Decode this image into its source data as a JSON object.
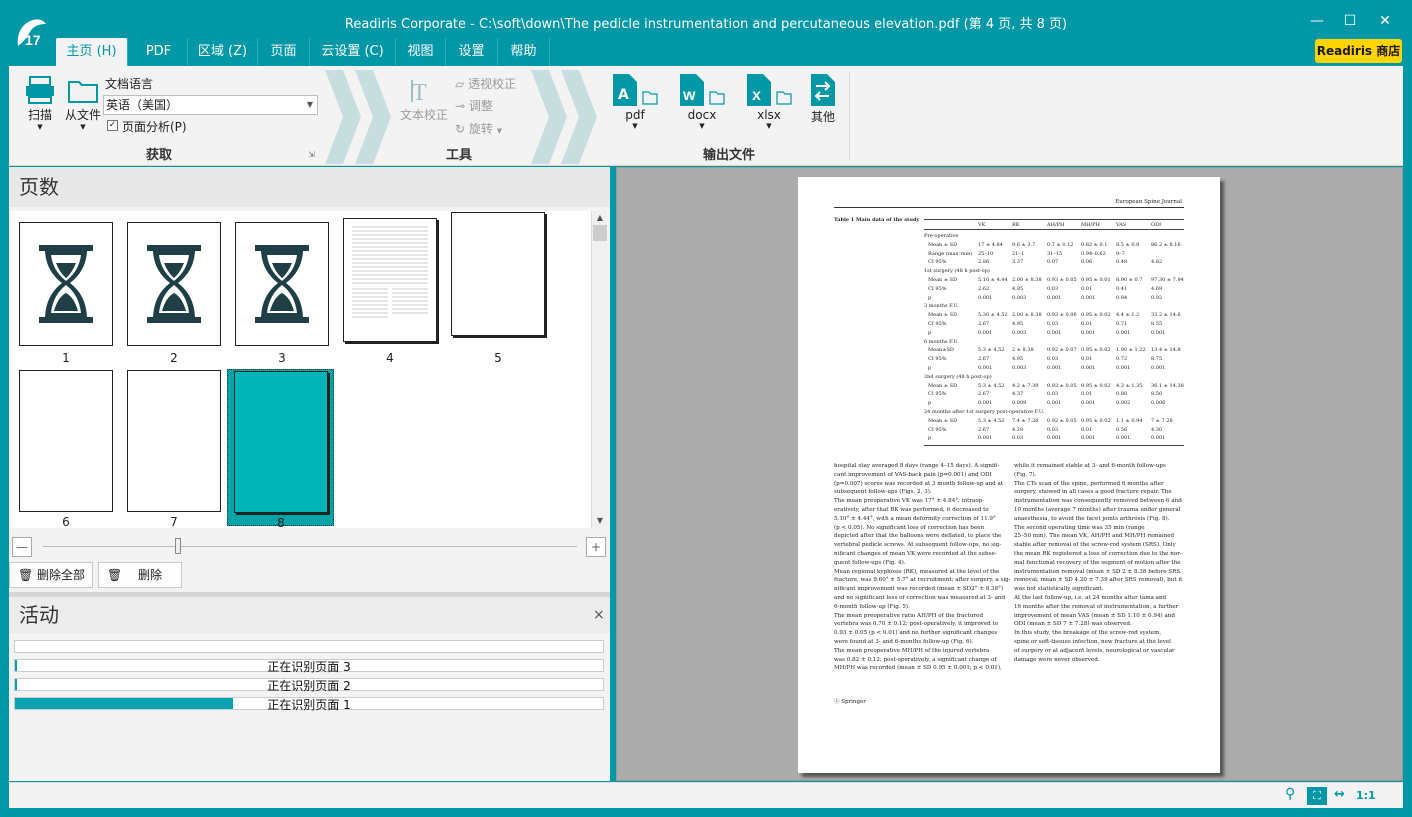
{
  "window": {
    "title": "Readiris Corporate - C:\\soft\\down\\The pedicle instrumentation and percutaneous elevation.pdf (第 4 页, 共 8 页)",
    "logo_text": "17",
    "minimize": "—",
    "maximize": "☐",
    "close": "✕"
  },
  "tabs": [
    "主页 (H)",
    "PDF",
    "区域 (Z)",
    "页面",
    "云设置 (C)",
    "视图",
    "设置",
    "帮助"
  ],
  "store_label": "Readiris 商店",
  "ribbon": {
    "acquire": {
      "scan": "扫描",
      "from_file": "从文件",
      "lang_label": "文档语言",
      "lang_value": "英语（美国）",
      "page_analysis": "页面分析(P)",
      "group": "获取"
    },
    "tools": {
      "text_correct": "文本校正",
      "perspective": "透视校正",
      "adjust": "调整",
      "rotate": "旋转",
      "group": "工具"
    },
    "output": {
      "pdf": "pdf",
      "docx": "docx",
      "xlsx": "xlsx",
      "other": "其他",
      "group": "输出文件"
    }
  },
  "pages_panel": {
    "title": "页数",
    "page_numbers": [
      "1",
      "2",
      "3",
      "4",
      "5",
      "6",
      "7",
      "8"
    ],
    "delete_all": "删除全部",
    "delete": "删除"
  },
  "activity_panel": {
    "title": "活动",
    "close": "×",
    "rows": [
      {
        "text": "",
        "progress": 0
      },
      {
        "text": "正在识别页面 3",
        "progress": 0.003
      },
      {
        "text": "正在识别页面 2",
        "progress": 0.003
      },
      {
        "text": "正在识别页面 1",
        "progress": 0.37
      }
    ]
  },
  "document": {
    "journal": "European Spine Journal",
    "table_caption": "Table 1  Main data of the study",
    "table_headers": [
      "VK",
      "RK",
      "AH/PH",
      "MH/PH",
      "VAS",
      "ODI"
    ],
    "table_rows": [
      [
        "Pre-operative",
        "",
        "",
        "",
        "",
        "",
        ""
      ],
      [
        "Mean ± SD",
        "17 ± 4.84",
        "9.6 ± 3.7",
        "0.7 ± 0.12",
        "0.82 ± 0.1",
        "8.5 ± 0.8",
        "86.2 ± 8.16"
      ],
      [
        "Range (max–min)",
        "25–10",
        "21–1",
        "31–15",
        "0.94–0.62",
        "9–7",
        ""
      ],
      [
        "CI 95%",
        "2.86",
        "3.37",
        "0.07",
        "0.06",
        "0.48",
        "4.82"
      ],
      [
        "1st surgery (48 h post-op)",
        "",
        "",
        "",
        "",
        "",
        ""
      ],
      [
        "Mean ± SD",
        "5.10 ± 4.44",
        "2.00 ± 8.38",
        "0.93 ± 0.05",
        "0.95 ± 0.01",
        "8.90 ± 0.7",
        "97.30 ± 7.94"
      ],
      [
        "CI 95%",
        "2.62",
        "4.95",
        "0.03",
        "0.01",
        "0.41",
        "4.69"
      ],
      [
        "p",
        "0.001",
        "0.003",
        "0.001",
        "0.001",
        "0.84",
        "0.92"
      ],
      [
        "3 months F.U.",
        "",
        "",
        "",
        "",
        "",
        ""
      ],
      [
        "Mean ± SD",
        "5.30 ± 4.52",
        "2.00 ± 8.38",
        "0.93 ± 0.06",
        "0.95 ± 0.02",
        "4.4 ± 1.2",
        "33.2 ± 14.6"
      ],
      [
        "CI 95%",
        "2.67",
        "4.95",
        "0.03",
        "0.01",
        "0.71",
        "8.55"
      ],
      [
        "p",
        "0.001",
        "0.003",
        "0.001",
        "0.001",
        "0.001",
        "0.001"
      ],
      [
        "6 months F.U.",
        "",
        "",
        "",
        "",
        "",
        ""
      ],
      [
        "Mean±SD",
        "5.3 ± 4.52",
        "2 ± 8.38",
        "0.92 ± 0.07",
        "0.95 ± 0.02",
        "1.90 ± 1.22",
        "13.4 ± 14.8"
      ],
      [
        "CI 95%",
        "2.67",
        "4.95",
        "0.03",
        "0.01",
        "0.72",
        "8.75"
      ],
      [
        "p",
        "0.001",
        "0.003",
        "0.001",
        "0.001",
        "0.001",
        "0.001"
      ],
      [
        "2nd surgery (48 h post-op)",
        "",
        "",
        "",
        "",
        "",
        ""
      ],
      [
        "Mean ± SD",
        "5.3 ± 4.52",
        "4.2 ± 7.39",
        "0.92 ± 0.05",
        "0.95 ± 0.02",
        "4.3 ± 1.35",
        "36.1 ± 14.38"
      ],
      [
        "CI 95%",
        "2.67",
        "4.37",
        "0.03",
        "0.01",
        "0.80",
        "8.50"
      ],
      [
        "p",
        "0.001",
        "0.009",
        "0.001",
        "0.001",
        "0.002",
        "0.006"
      ],
      [
        "24 months after 1st surgery post-operative F.U.",
        "",
        "",
        "",
        "",
        "",
        ""
      ],
      [
        "Mean ± SD",
        "5.3 ± 4.52",
        "7.4 ± 7.26",
        "0.92 ± 0.05",
        "0.95 ± 0.02",
        "1.1 ± 0.94",
        "7 ± 7.28"
      ],
      [
        "CI 95%",
        "2.67",
        "4.29",
        "0.03",
        "0.01",
        "0.56",
        "4.30"
      ],
      [
        "p",
        "0.001",
        "0.03",
        "0.001",
        "0.001",
        "0.001",
        "0.001"
      ]
    ],
    "col_left": [
      "hospital stay averaged 8 days (range 4–15 days). A signifi-",
      "cant improvement of VAS-back pain (p=0.001) and ODI",
      "(p=0.007) scores was recorded at 3 month follow-up and at",
      "subsequent follow-ups (Figs. 2, 3).",
      "    The mean preoperative VK was 17° ± 4.84°; intraop-",
      "eratively, after that BK was performed, it decreased to",
      "5.10° ± 4.44°, with a mean deformity correction of 11.9°",
      "(p < 0.05). No significant loss of correction has been",
      "depicted after that the balloons were deflated, to place the",
      "vertebral pedicle screws. At subsequent follow-ups, no sig-",
      "nificant changes of mean VK were recorded at the subse-",
      "quent follow-ups (Fig. 4).",
      "    Mean regional kyphosis (RK), measured at the level of the",
      "fracture, was 9.60° ± 5.7° at recruitment; after surgery, a sig-",
      "nificant improvement was recorded (mean ± SD2° ± 8.38°)",
      "and no significant loss of correction was measured at 3- and",
      "6-month follow-up (Fig. 5).",
      "    The mean preoperative ratio AH/PH of the fractured",
      "vertebra was 0.70 ± 0.12; post-operatively, it improved to",
      "0.93 ± 0.05 (p < 0.01) and no further significant changes",
      "were found at 3- and 6-months follow-up (Fig. 6).",
      "    The mean preoperative MH/PH of the injured vertebra",
      "was 0.82 ± 0.12; post-operatively, a significant change of",
      "MH/PH was recorded (mean ± SD 0.95 ± 0.001; p < 0.01),"
    ],
    "col_right": [
      "while it remained stable at 3- and 6-month follow-ups",
      "(Fig. 7).",
      "    The CTs scan of the spine, performed 6 months after",
      "surgery, showed in all cases a good fracture repair. The",
      "instrumentation was consequently removed between 6 and",
      "10 months (average 7 months) after trauma under general",
      "anaesthesia, to avoid the facet joints arthrosis (Fig. 8).",
      "    The second operating time was 35 min (range",
      "25–50 min). The mean VK, AH/PH and MH/PH remained",
      "stable after removal of the screw-rod system (SRS). Only",
      "the mean RK registered a loss of correction due to the nor-",
      "mal functional recovery of the segment of motion after the",
      "instrumentation removal (mean ± SD 2 ± 8.38 before SRS",
      "removal; mean ± SD 4.20 ± 7.39 after SRS removal), but it",
      "was not statistically significant.",
      "    At the last follow-up, i.e. at 24 months after tama and",
      "16 months after the removal of instrumentation, a further",
      "improvement of mean VAS (mean ± SD 1.10 ± 0.94) and",
      "ODI (mean ± SD 7 ± 7.28) was observed.",
      "    In this study, the breakage of the screw-rod system,",
      "spine or soft-tissues infection, new fracture at the level",
      "of surgery or at adjacent levels, neurological or vascular",
      "damage were never observed."
    ],
    "publisher": "Springer"
  },
  "statusbar": {
    "zoom": "1:1"
  },
  "colors": {
    "teal": "#0097a7",
    "selected": "#00b5b8",
    "store": "#ffd400"
  }
}
